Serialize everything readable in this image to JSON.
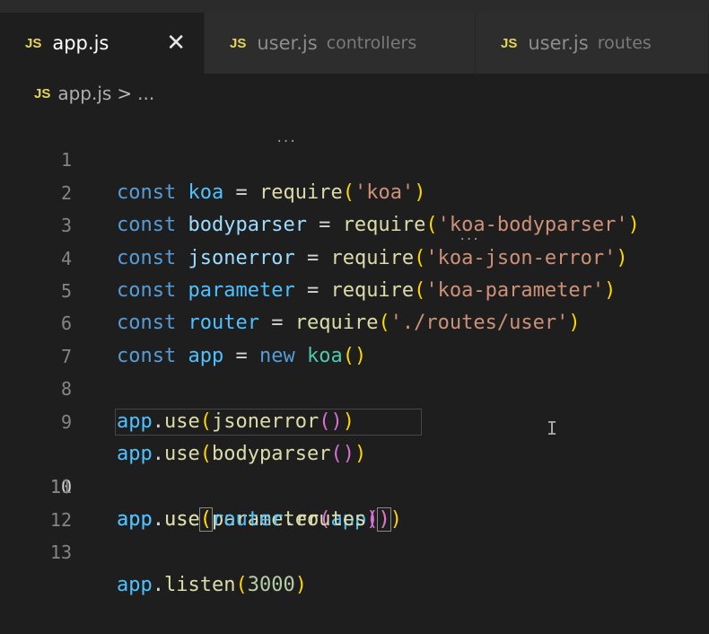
{
  "tabs": [
    {
      "icon": "JS",
      "label": "app.js",
      "active": true,
      "close": "✕"
    },
    {
      "icon": "JS",
      "label": "user.js",
      "description": "controllers"
    },
    {
      "icon": "JS",
      "label": "user.js",
      "description": "routes"
    }
  ],
  "breadcrumb": {
    "icon": "JS",
    "file": "app.js",
    "separator": ">",
    "more": "..."
  },
  "editor": {
    "line_numbers": [
      "1",
      "2",
      "3",
      "4",
      "5",
      "6",
      "7",
      "8",
      "9",
      "10",
      "11",
      "12",
      "13"
    ],
    "current_line": "10",
    "l1": {
      "kw": "const",
      "name": "koa",
      "eq": " = ",
      "fn": "require",
      "o": "(",
      "s": "'koa'",
      "c": ")"
    },
    "l2": {
      "kw": "const",
      "name": "bodyparser",
      "eq": " = ",
      "fn": "require",
      "o": "(",
      "s": "'koa-bodyparser'",
      "c": ")"
    },
    "l3": {
      "kw": "const",
      "name": "jsonerror",
      "eq": " = ",
      "fn": "require",
      "o": "(",
      "s": "'koa-json-error'",
      "c": ")"
    },
    "l4": {
      "kw": "const",
      "name": "parameter",
      "eq": " = ",
      "fn": "require",
      "o": "(",
      "s": "'koa-parameter'",
      "c": ")"
    },
    "l5": {
      "kw": "const",
      "name": "router",
      "eq": " = ",
      "fn": "require",
      "o": "(",
      "s": "'./routes/user'",
      "c": ")"
    },
    "l6": {
      "kw": "const",
      "name": "app",
      "eq": " = ",
      "new": "new",
      "cls": "koa",
      "o": "(",
      "c": ")"
    },
    "l8": {
      "obj": "app",
      "dot": ".",
      "m": "use",
      "o1": "(",
      "fn": "jsonerror",
      "o2": "(",
      "c2": ")",
      "c1": ")"
    },
    "l9": {
      "obj": "app",
      "dot": ".",
      "m": "use",
      "o1": "(",
      "fn": "bodyparser",
      "o2": "(",
      "c2": ")",
      "c1": ")"
    },
    "l10": {
      "obj": "app",
      "dot": ".",
      "m": "use",
      "o1": "(",
      "fn": "parameter",
      "o2": "(",
      "arg": "app",
      "c2": ")",
      "c1": ")"
    },
    "l11": {
      "obj": "app",
      "dot": ".",
      "m": "use",
      "o1": "(",
      "obj2": "router",
      "dot2": ".",
      "fn": "routes",
      "o2": "(",
      "c2": ")",
      "c1": ")"
    },
    "l13": {
      "obj": "app",
      "dot": ".",
      "m": "listen",
      "o": "(",
      "num": "3000",
      "c": ")"
    },
    "hint_dots": "..."
  },
  "cursor_glyph": "I",
  "colors": {
    "background": "#1e1e1e",
    "keyword": "#569cd6",
    "variable": "#9cdcfe",
    "function": "#dcdcaa",
    "string": "#ce9178",
    "number": "#b5cea8",
    "js_icon": "#e5d55a"
  }
}
